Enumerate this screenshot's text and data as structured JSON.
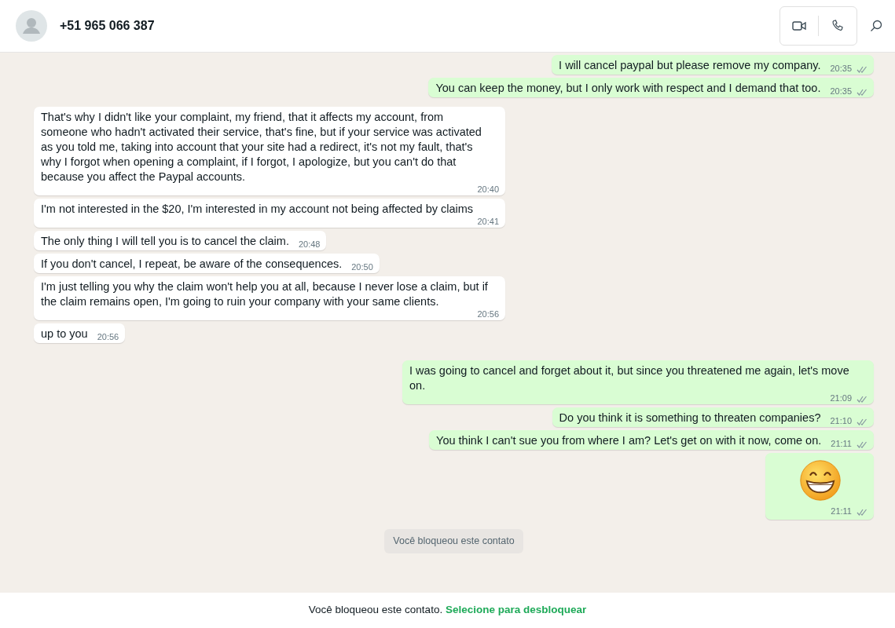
{
  "header": {
    "contact": "+51 965 066 387"
  },
  "messages": [
    {
      "outgoing": true,
      "kind": "text",
      "text": "I will cancel paypal but please remove my company.",
      "time": "20:35",
      "delivered": true
    },
    {
      "outgoing": true,
      "kind": "text",
      "text": "You can keep the money, but I only work with respect and I demand that too.",
      "time": "20:35",
      "delivered": true
    },
    {
      "outgoing": false,
      "kind": "text",
      "text": "That's why I didn't like your complaint, my friend, that it affects my account, from someone who hadn't activated their service, that's fine, but if your service was activated as you told me, taking into account that your site had a redirect, it's not my fault, that's why I forgot when opening a complaint, if I forgot, I apologize, but you can't do that because you affect the Paypal accounts.",
      "time": "20:40"
    },
    {
      "outgoing": false,
      "kind": "text",
      "text": "I'm not interested in the $20, I'm interested in my account not being affected by claims",
      "time": "20:41"
    },
    {
      "outgoing": false,
      "kind": "text",
      "text": "The only thing I will tell you is to cancel the claim.",
      "time": "20:48"
    },
    {
      "outgoing": false,
      "kind": "text",
      "text": "If you don't cancel, I repeat, be aware of the consequences.",
      "time": "20:50"
    },
    {
      "outgoing": false,
      "kind": "text",
      "text": "I'm just telling you why the claim won't help you at all, because I never lose a claim, but if the claim remains open, I'm going to ruin your company with your same clients.",
      "time": "20:56"
    },
    {
      "outgoing": false,
      "kind": "text",
      "text": "up to you",
      "time": "20:56"
    },
    {
      "outgoing": true,
      "kind": "text",
      "text": "I was going to cancel and forget about it, but since you threatened me again, let's move on.",
      "time": "21:09",
      "delivered": true
    },
    {
      "outgoing": true,
      "kind": "text",
      "text": "Do you think it is something to threaten companies?",
      "time": "21:10",
      "delivered": true
    },
    {
      "outgoing": true,
      "kind": "text",
      "text": "You think I can't sue you from where I am? Let's get on with it now, come on.",
      "time": "21:11",
      "delivered": true
    },
    {
      "outgoing": true,
      "kind": "emoji",
      "time": "21:11",
      "delivered": true
    }
  ],
  "system_notice": "Você bloqueou este contato",
  "footer": {
    "text": "Você bloqueou este contato.",
    "link": "Selecione para desbloquear"
  }
}
